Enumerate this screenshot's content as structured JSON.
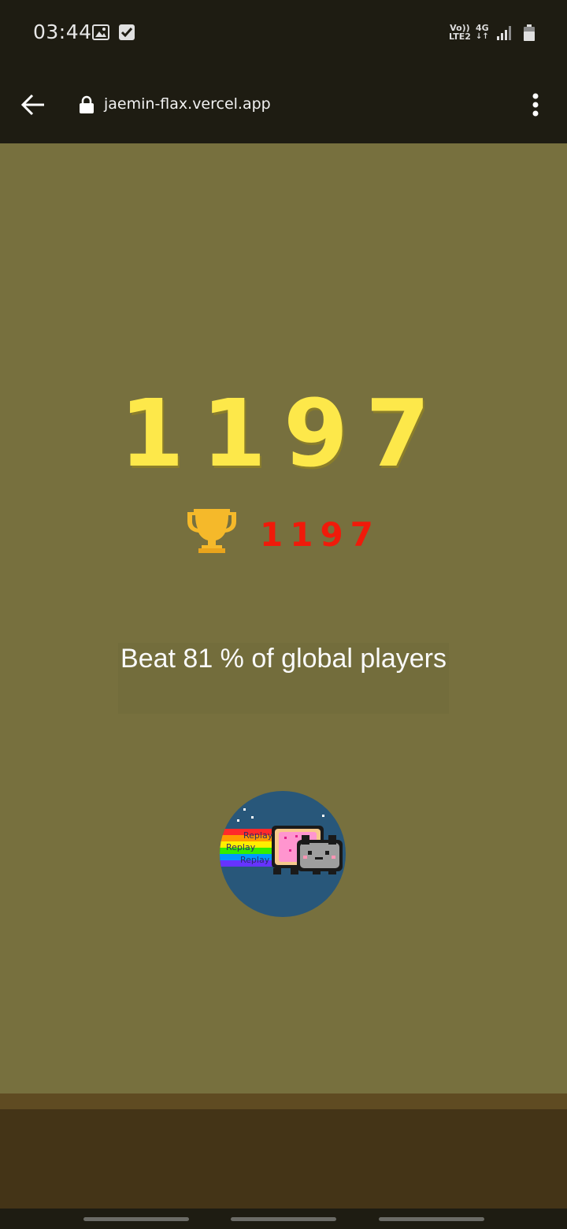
{
  "status_bar": {
    "time": "03:44",
    "network_label_top": "Vo))",
    "network_label_bottom": "LTE2",
    "network_type": "4G",
    "icons": [
      "image-icon",
      "check-icon",
      "signal-icon",
      "battery-icon"
    ]
  },
  "browser": {
    "url": "jaemin-flax.vercel.app",
    "icons": [
      "back-arrow-icon",
      "lock-icon",
      "more-vert-icon"
    ]
  },
  "game": {
    "score": "1197",
    "best_score": "1197",
    "beat_text": "Beat 81 % of global players",
    "replay_labels": [
      "Replay",
      "Replay",
      "Replay"
    ],
    "colors": {
      "background": "#77703e",
      "score": "#fde84a",
      "best_score": "#f01a0a",
      "replay_circle": "#28577a"
    }
  }
}
